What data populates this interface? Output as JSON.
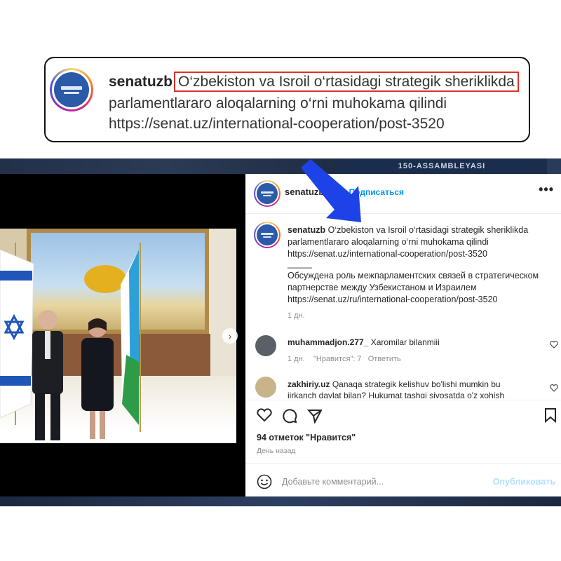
{
  "callout": {
    "username": "senatuzb",
    "highlighted_text": "O‘zbekiston va Isroil o‘rtasidagi strategik sheriklikda",
    "line2": "parlamentlararo aloqalarning o‘rni muhokama qilindi",
    "line3": "https://senat.uz/international-cooperation/post-3520"
  },
  "background": {
    "banner_text": "150-ASSAMBLEYASI"
  },
  "post": {
    "header": {
      "username": "senatuzb",
      "follow_label": "•  Подписаться",
      "more_label": "•••"
    },
    "caption": {
      "username": "senatuzb",
      "line1": "O‘zbekiston va Isroil o‘rtasidagi strategik sheriklikda",
      "line2": "parlamentlararo aloqalarning o‘rni muhokama qilindi",
      "line3": "https://senat.uz/international-cooperation/post-3520",
      "separator": "_____",
      "ru_line1": "Обсуждена роль межпарламентских связей в стратегическом",
      "ru_line2": "партнерстве между Узбекистаном и Израилем",
      "ru_line3": "https://senat.uz/ru/international-cooperation/post-3520",
      "time": "1 дн."
    },
    "comments": [
      {
        "username": "muhammadjon.277_",
        "text": "Xaromilar bilanmiii",
        "time": "1 дн.",
        "likes": "\"Нравится\": 7",
        "reply": "Ответить"
      },
      {
        "username": "zakhiriy.uz",
        "text": "Qanaqa strategik kelishuv bo'lishi mumkin bu",
        "text2": "iirkanch davlat bilan? Hukumat tashqi siyosatda o'z xohish"
      }
    ],
    "likes_label": "94 отметок \"Нравится\"",
    "ago_label": "День назад",
    "add_comment_placeholder": "Добавьте комментарий...",
    "publish_label": "Опубликовать"
  },
  "colors": {
    "arrow": "#1d43e8",
    "highlight_box": "#d9322d",
    "ig_link": "#0095f6"
  },
  "icons": [
    "heart-icon",
    "comment-icon",
    "share-icon",
    "bookmark-icon",
    "emoji-icon",
    "chevron-right-icon",
    "more-icon",
    "arrow-annotation-icon"
  ]
}
